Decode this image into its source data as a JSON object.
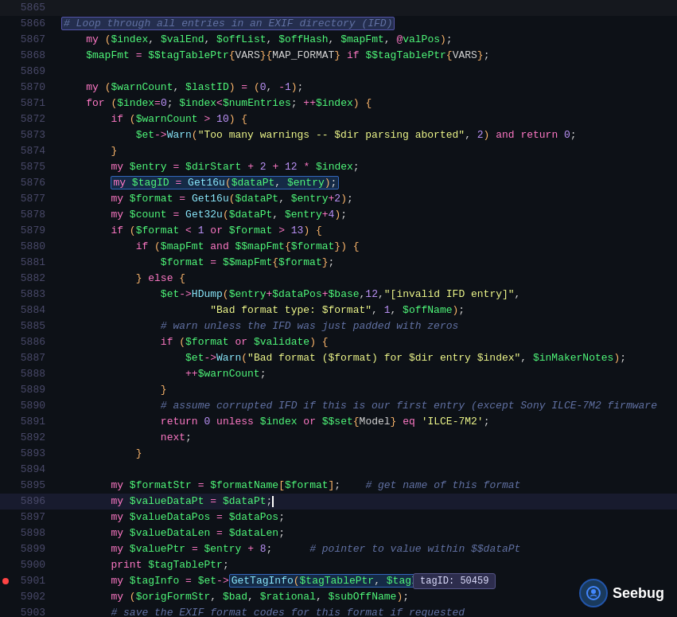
{
  "lines": [
    {
      "num": "5865",
      "content": "",
      "type": "normal"
    },
    {
      "num": "5866",
      "content": "comment_loop",
      "type": "comment_loop"
    },
    {
      "num": "5867",
      "content": "line_5867",
      "type": "code"
    },
    {
      "num": "5868",
      "content": "line_5868",
      "type": "code"
    },
    {
      "num": "5869",
      "content": "",
      "type": "normal"
    },
    {
      "num": "5870",
      "content": "line_5870",
      "type": "code"
    },
    {
      "num": "5871",
      "content": "line_5871",
      "type": "code"
    },
    {
      "num": "5872",
      "content": "line_5872",
      "type": "code"
    },
    {
      "num": "5873",
      "content": "line_5873",
      "type": "code"
    },
    {
      "num": "5874",
      "content": "line_5874",
      "type": "code"
    },
    {
      "num": "5875",
      "content": "line_5875",
      "type": "code"
    },
    {
      "num": "5876",
      "content": "line_5876",
      "type": "highlighted"
    },
    {
      "num": "5877",
      "content": "line_5877",
      "type": "code"
    },
    {
      "num": "5878",
      "content": "line_5878",
      "type": "code"
    },
    {
      "num": "5879",
      "content": "line_5879",
      "type": "code"
    },
    {
      "num": "5880",
      "content": "line_5880",
      "type": "code"
    },
    {
      "num": "5881",
      "content": "line_5881",
      "type": "code"
    },
    {
      "num": "5882",
      "content": "line_5882",
      "type": "code"
    },
    {
      "num": "5883",
      "content": "line_5883",
      "type": "code"
    },
    {
      "num": "5884",
      "content": "line_5884",
      "type": "code"
    },
    {
      "num": "5885",
      "content": "line_5885",
      "type": "comment"
    },
    {
      "num": "5886",
      "content": "line_5886",
      "type": "code"
    },
    {
      "num": "5887",
      "content": "line_5887",
      "type": "code"
    },
    {
      "num": "5888",
      "content": "line_5888",
      "type": "code"
    },
    {
      "num": "5889",
      "content": "line_5889",
      "type": "code"
    },
    {
      "num": "5890",
      "content": "line_5890",
      "type": "comment"
    },
    {
      "num": "5891",
      "content": "line_5891",
      "type": "code"
    },
    {
      "num": "5892",
      "content": "line_5892",
      "type": "code"
    },
    {
      "num": "5893",
      "content": "line_5893",
      "type": "code"
    },
    {
      "num": "5894",
      "content": "",
      "type": "normal"
    },
    {
      "num": "5895",
      "content": "line_5895",
      "type": "code"
    },
    {
      "num": "5896",
      "content": "line_5896",
      "type": "highlighted2"
    },
    {
      "num": "5897",
      "content": "line_5897",
      "type": "code"
    },
    {
      "num": "5898",
      "content": "line_5898",
      "type": "code"
    },
    {
      "num": "5899",
      "content": "line_5899",
      "type": "code"
    },
    {
      "num": "5900",
      "content": "line_5900",
      "type": "code"
    },
    {
      "num": "5901",
      "content": "line_5901",
      "type": "current",
      "dot": "red"
    },
    {
      "num": "5902",
      "content": "line_5902",
      "type": "code"
    },
    {
      "num": "5903",
      "content": "line_5903",
      "type": "comment_line"
    }
  ],
  "tooltip": "tagID: 50459",
  "logo_text": "Seebug"
}
